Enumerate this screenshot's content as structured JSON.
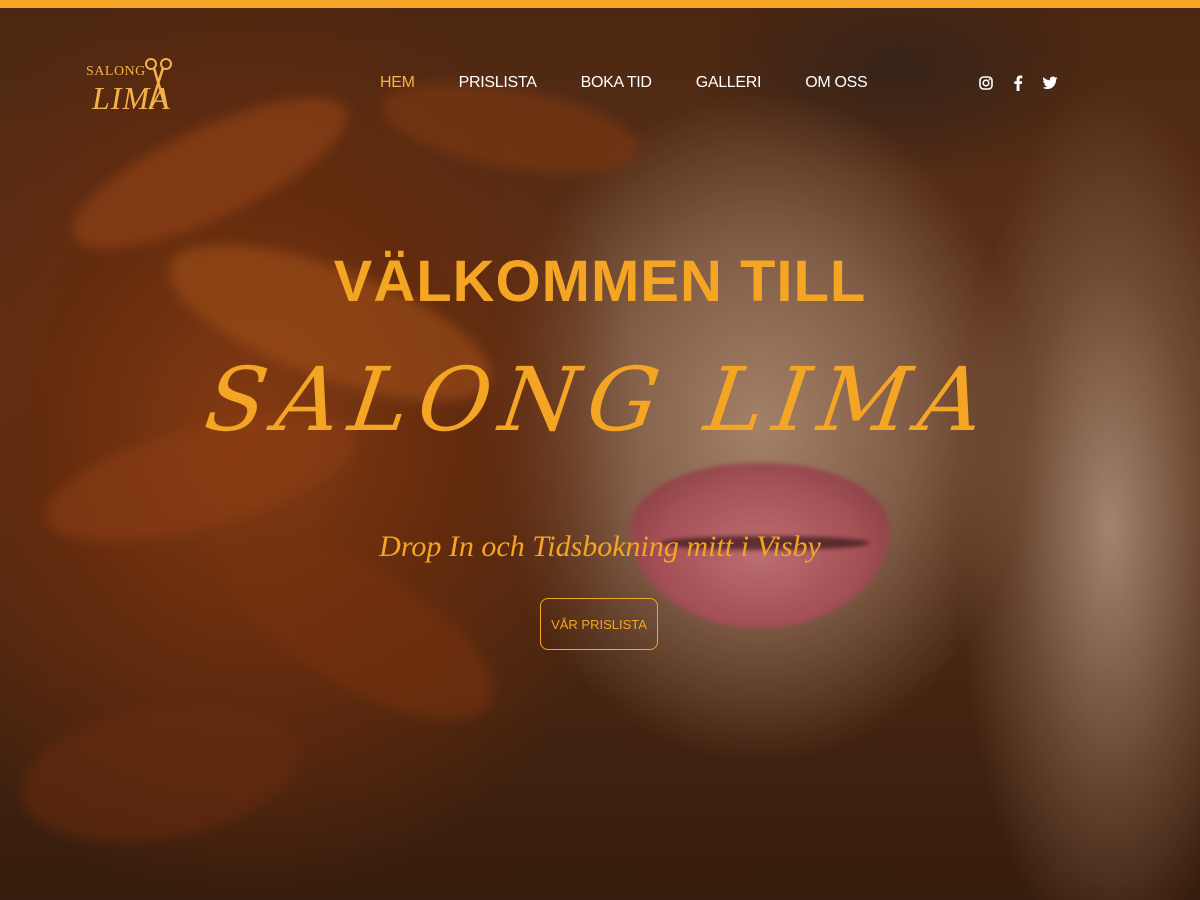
{
  "brand": {
    "logo_top": "SALONG",
    "logo_bottom": "LIMA"
  },
  "nav": {
    "items": [
      {
        "label": "HEM",
        "active": true
      },
      {
        "label": "PRISLISTA",
        "active": false
      },
      {
        "label": "BOKA TID",
        "active": false
      },
      {
        "label": "GALLERI",
        "active": false
      },
      {
        "label": "OM OSS",
        "active": false
      }
    ]
  },
  "social": {
    "icons": [
      "instagram-icon",
      "facebook-icon",
      "twitter-icon"
    ]
  },
  "hero": {
    "title": "VÄLKOMMEN TILL",
    "brand": "SALONG LIMA",
    "tagline": "Drop In och Tidsbokning mitt i Visby",
    "cta_label": "VÅR PRISLISTA"
  },
  "colors": {
    "accent": "#f5a524",
    "nav_text": "#ffffff"
  }
}
